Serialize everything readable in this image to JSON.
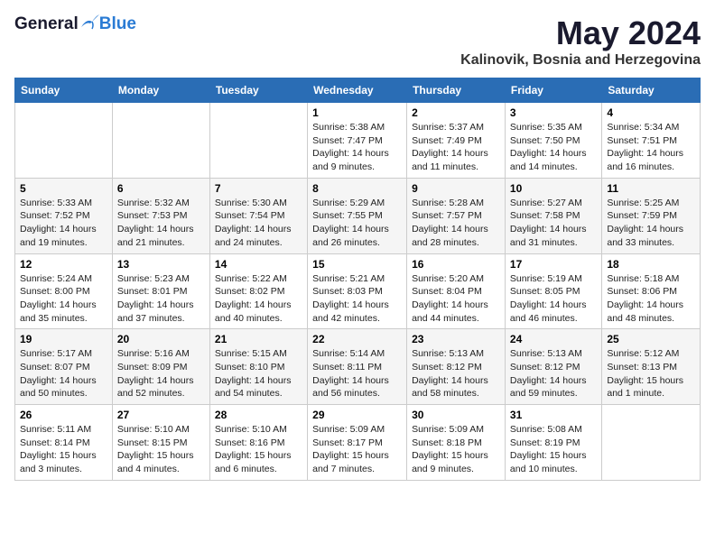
{
  "header": {
    "logo_general": "General",
    "logo_blue": "Blue",
    "month": "May 2024",
    "location": "Kalinovik, Bosnia and Herzegovina"
  },
  "weekdays": [
    "Sunday",
    "Monday",
    "Tuesday",
    "Wednesday",
    "Thursday",
    "Friday",
    "Saturday"
  ],
  "weeks": [
    [
      {
        "day": "",
        "info": ""
      },
      {
        "day": "",
        "info": ""
      },
      {
        "day": "",
        "info": ""
      },
      {
        "day": "1",
        "info": "Sunrise: 5:38 AM\nSunset: 7:47 PM\nDaylight: 14 hours\nand 9 minutes."
      },
      {
        "day": "2",
        "info": "Sunrise: 5:37 AM\nSunset: 7:49 PM\nDaylight: 14 hours\nand 11 minutes."
      },
      {
        "day": "3",
        "info": "Sunrise: 5:35 AM\nSunset: 7:50 PM\nDaylight: 14 hours\nand 14 minutes."
      },
      {
        "day": "4",
        "info": "Sunrise: 5:34 AM\nSunset: 7:51 PM\nDaylight: 14 hours\nand 16 minutes."
      }
    ],
    [
      {
        "day": "5",
        "info": "Sunrise: 5:33 AM\nSunset: 7:52 PM\nDaylight: 14 hours\nand 19 minutes."
      },
      {
        "day": "6",
        "info": "Sunrise: 5:32 AM\nSunset: 7:53 PM\nDaylight: 14 hours\nand 21 minutes."
      },
      {
        "day": "7",
        "info": "Sunrise: 5:30 AM\nSunset: 7:54 PM\nDaylight: 14 hours\nand 24 minutes."
      },
      {
        "day": "8",
        "info": "Sunrise: 5:29 AM\nSunset: 7:55 PM\nDaylight: 14 hours\nand 26 minutes."
      },
      {
        "day": "9",
        "info": "Sunrise: 5:28 AM\nSunset: 7:57 PM\nDaylight: 14 hours\nand 28 minutes."
      },
      {
        "day": "10",
        "info": "Sunrise: 5:27 AM\nSunset: 7:58 PM\nDaylight: 14 hours\nand 31 minutes."
      },
      {
        "day": "11",
        "info": "Sunrise: 5:25 AM\nSunset: 7:59 PM\nDaylight: 14 hours\nand 33 minutes."
      }
    ],
    [
      {
        "day": "12",
        "info": "Sunrise: 5:24 AM\nSunset: 8:00 PM\nDaylight: 14 hours\nand 35 minutes."
      },
      {
        "day": "13",
        "info": "Sunrise: 5:23 AM\nSunset: 8:01 PM\nDaylight: 14 hours\nand 37 minutes."
      },
      {
        "day": "14",
        "info": "Sunrise: 5:22 AM\nSunset: 8:02 PM\nDaylight: 14 hours\nand 40 minutes."
      },
      {
        "day": "15",
        "info": "Sunrise: 5:21 AM\nSunset: 8:03 PM\nDaylight: 14 hours\nand 42 minutes."
      },
      {
        "day": "16",
        "info": "Sunrise: 5:20 AM\nSunset: 8:04 PM\nDaylight: 14 hours\nand 44 minutes."
      },
      {
        "day": "17",
        "info": "Sunrise: 5:19 AM\nSunset: 8:05 PM\nDaylight: 14 hours\nand 46 minutes."
      },
      {
        "day": "18",
        "info": "Sunrise: 5:18 AM\nSunset: 8:06 PM\nDaylight: 14 hours\nand 48 minutes."
      }
    ],
    [
      {
        "day": "19",
        "info": "Sunrise: 5:17 AM\nSunset: 8:07 PM\nDaylight: 14 hours\nand 50 minutes."
      },
      {
        "day": "20",
        "info": "Sunrise: 5:16 AM\nSunset: 8:09 PM\nDaylight: 14 hours\nand 52 minutes."
      },
      {
        "day": "21",
        "info": "Sunrise: 5:15 AM\nSunset: 8:10 PM\nDaylight: 14 hours\nand 54 minutes."
      },
      {
        "day": "22",
        "info": "Sunrise: 5:14 AM\nSunset: 8:11 PM\nDaylight: 14 hours\nand 56 minutes."
      },
      {
        "day": "23",
        "info": "Sunrise: 5:13 AM\nSunset: 8:12 PM\nDaylight: 14 hours\nand 58 minutes."
      },
      {
        "day": "24",
        "info": "Sunrise: 5:13 AM\nSunset: 8:12 PM\nDaylight: 14 hours\nand 59 minutes."
      },
      {
        "day": "25",
        "info": "Sunrise: 5:12 AM\nSunset: 8:13 PM\nDaylight: 15 hours\nand 1 minute."
      }
    ],
    [
      {
        "day": "26",
        "info": "Sunrise: 5:11 AM\nSunset: 8:14 PM\nDaylight: 15 hours\nand 3 minutes."
      },
      {
        "day": "27",
        "info": "Sunrise: 5:10 AM\nSunset: 8:15 PM\nDaylight: 15 hours\nand 4 minutes."
      },
      {
        "day": "28",
        "info": "Sunrise: 5:10 AM\nSunset: 8:16 PM\nDaylight: 15 hours\nand 6 minutes."
      },
      {
        "day": "29",
        "info": "Sunrise: 5:09 AM\nSunset: 8:17 PM\nDaylight: 15 hours\nand 7 minutes."
      },
      {
        "day": "30",
        "info": "Sunrise: 5:09 AM\nSunset: 8:18 PM\nDaylight: 15 hours\nand 9 minutes."
      },
      {
        "day": "31",
        "info": "Sunrise: 5:08 AM\nSunset: 8:19 PM\nDaylight: 15 hours\nand 10 minutes."
      },
      {
        "day": "",
        "info": ""
      }
    ]
  ]
}
